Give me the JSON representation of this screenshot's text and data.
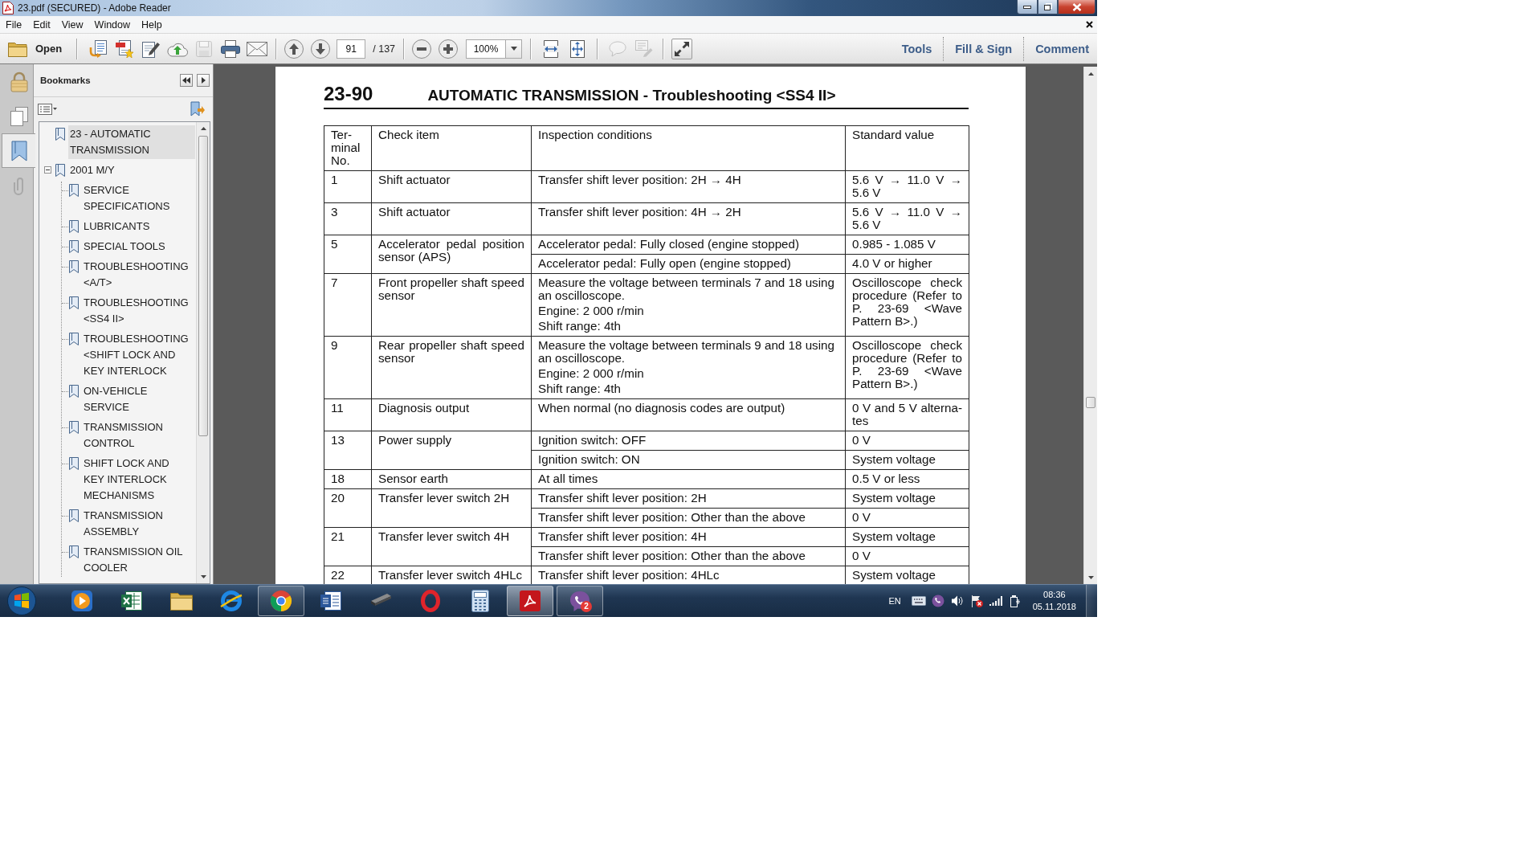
{
  "window": {
    "title": "23.pdf (SECURED) - Adobe Reader"
  },
  "menu_bar": {
    "items": [
      "File",
      "Edit",
      "View",
      "Window",
      "Help"
    ]
  },
  "toolbar": {
    "open_label": "Open",
    "file_tools": [
      {
        "kind": "export",
        "disabled": false
      },
      {
        "kind": "create",
        "disabled": false
      },
      {
        "kind": "sign",
        "disabled": false
      },
      {
        "kind": "upload",
        "disabled": false
      },
      {
        "kind": "save",
        "disabled": true
      },
      {
        "kind": "print",
        "disabled": false
      },
      {
        "kind": "email",
        "disabled": false
      }
    ],
    "page_number": "91",
    "page_count": "/ 137",
    "zoom": "100%",
    "comment_tools": [
      {
        "kind": "comment",
        "disabled": true
      },
      {
        "kind": "typewriter",
        "disabled": true
      }
    ],
    "panels": [
      "Tools",
      "Fill & Sign",
      "Comment"
    ]
  },
  "side_tabs": [
    {
      "kind": "lock",
      "selected": false
    },
    {
      "kind": "pages",
      "selected": false
    },
    {
      "kind": "bookmarks",
      "selected": true
    },
    {
      "kind": "attachments",
      "selected": false
    }
  ],
  "bookmarks": {
    "title": "Bookmarks",
    "items": [
      {
        "label": "23 - AUTOMATIC TRANSMISSION",
        "selected": true
      },
      {
        "label": "2001 M/Y",
        "selected": false,
        "expanded": true,
        "children": [
          {
            "label": "SERVICE SPECIFICATIONS",
            "selected": false
          },
          {
            "label": "LUBRICANTS",
            "selected": false
          },
          {
            "label": "SPECIAL TOOLS",
            "selected": false
          },
          {
            "label": "TROUBLESHOOTING <A/T>",
            "selected": false
          },
          {
            "label": "TROUBLESHOOTING <SS4 II>",
            "selected": false
          },
          {
            "label": "TROUBLESHOOTING <SHIFT LOCK AND KEY INTERLOCK",
            "selected": false
          },
          {
            "label": "ON-VEHICLE SERVICE",
            "selected": false
          },
          {
            "label": "TRANSMISSION CONTROL",
            "selected": false
          },
          {
            "label": "SHIFT LOCK AND KEY INTERLOCK MECHANISMS",
            "selected": false
          },
          {
            "label": "TRANSMISSION ASSEMBLY",
            "selected": false
          },
          {
            "label": "TRANSMISSION OIL COOLER",
            "selected": false
          }
        ]
      }
    ]
  },
  "document": {
    "page_label": "23-90",
    "title": "AUTOMATIC TRANSMISSION - Troubleshooting <SS4 II>",
    "table": {
      "columns": [
        "Ter-minal No.",
        "Check item",
        "Inspection conditions",
        "Standard value"
      ],
      "rows": [
        {
          "terminal": "1",
          "check_item": "Shift actuator",
          "conditions": [
            {
              "text": [
                "Transfer shift lever position: 2H → 4H"
              ],
              "value": "5.6 V → 11.0 V → 5.6 V"
            }
          ]
        },
        {
          "terminal": "3",
          "check_item": "Shift actuator",
          "conditions": [
            {
              "text": [
                "Transfer shift lever position: 4H → 2H"
              ],
              "value": "5.6 V → 11.0 V → 5.6 V"
            }
          ]
        },
        {
          "terminal": "5",
          "check_item": "Accelerator pedal position sensor (APS)",
          "conditions": [
            {
              "text": [
                "Accelerator pedal: Fully closed (engine stopped)"
              ],
              "value": "0.985 - 1.085 V"
            },
            {
              "text": [
                "Accelerator pedal: Fully open (engine stopped)"
              ],
              "value": "4.0 V or higher"
            }
          ]
        },
        {
          "terminal": "7",
          "check_item": "Front propeller shaft speed sensor",
          "conditions": [
            {
              "text": [
                "Measure the voltage between terminals 7 and 18 using an oscilloscope.",
                "Engine: 2 000 r/min",
                "Shift range: 4th"
              ],
              "value": "Oscilloscope check procedure (Refer to P. 23-69 <Wave Pattern B>.)"
            }
          ]
        },
        {
          "terminal": "9",
          "check_item": "Rear propeller shaft speed sensor",
          "conditions": [
            {
              "text": [
                "Measure the voltage between terminals 9 and 18 using an oscilloscope.",
                "Engine: 2 000 r/min",
                "Shift range: 4th"
              ],
              "value": "Oscilloscope check procedure (Refer to P. 23-69 <Wave Pattern B>.)"
            }
          ]
        },
        {
          "terminal": "11",
          "check_item": "Diagnosis output",
          "conditions": [
            {
              "text": [
                "When normal (no diagnosis codes are output)"
              ],
              "value": "0 V and 5 V alterna-tes"
            }
          ]
        },
        {
          "terminal": "13",
          "check_item": "Power supply",
          "conditions": [
            {
              "text": [
                "Ignition switch: OFF"
              ],
              "value": "0 V"
            },
            {
              "text": [
                "Ignition switch: ON"
              ],
              "value": "System voltage"
            }
          ]
        },
        {
          "terminal": "18",
          "check_item": "Sensor earth",
          "conditions": [
            {
              "text": [
                "At all times"
              ],
              "value": "0.5 V or less"
            }
          ]
        },
        {
          "terminal": "20",
          "check_item": "Transfer lever switch 2H",
          "conditions": [
            {
              "text": [
                "Transfer shift lever position: 2H"
              ],
              "value": "System voltage"
            },
            {
              "text": [
                "Transfer shift lever position: Other than the above"
              ],
              "value": "0 V"
            }
          ]
        },
        {
          "terminal": "21",
          "check_item": "Transfer lever switch 4H",
          "conditions": [
            {
              "text": [
                "Transfer shift lever position: 4H"
              ],
              "value": "System voltage"
            },
            {
              "text": [
                "Transfer shift lever position: Other than the above"
              ],
              "value": "0 V"
            }
          ]
        },
        {
          "terminal": "22",
          "check_item": "Transfer lever switch 4HLc",
          "conditions": [
            {
              "text": [
                "Transfer shift lever position: 4HLc"
              ],
              "value": "System voltage"
            }
          ]
        }
      ]
    }
  },
  "taskbar": {
    "apps": [
      {
        "kind": "media",
        "running": false,
        "selected": false
      },
      {
        "kind": "spreadsheet",
        "running": false,
        "selected": false
      },
      {
        "kind": "folder",
        "running": false,
        "selected": false
      },
      {
        "kind": "browser-e",
        "running": false,
        "selected": false
      },
      {
        "kind": "browser-ring",
        "running": true,
        "selected": false
      },
      {
        "kind": "word-doc",
        "running": false,
        "selected": false
      },
      {
        "kind": "scanner",
        "running": false,
        "selected": false
      },
      {
        "kind": "ring",
        "running": false,
        "selected": false
      },
      {
        "kind": "calculator",
        "running": false,
        "selected": false
      },
      {
        "kind": "pdf",
        "running": true,
        "selected": true
      },
      {
        "kind": "messenger",
        "running": true,
        "selected": false,
        "badge": "2"
      }
    ],
    "language": "EN",
    "time": "08:36",
    "date": "05.11.2018"
  }
}
